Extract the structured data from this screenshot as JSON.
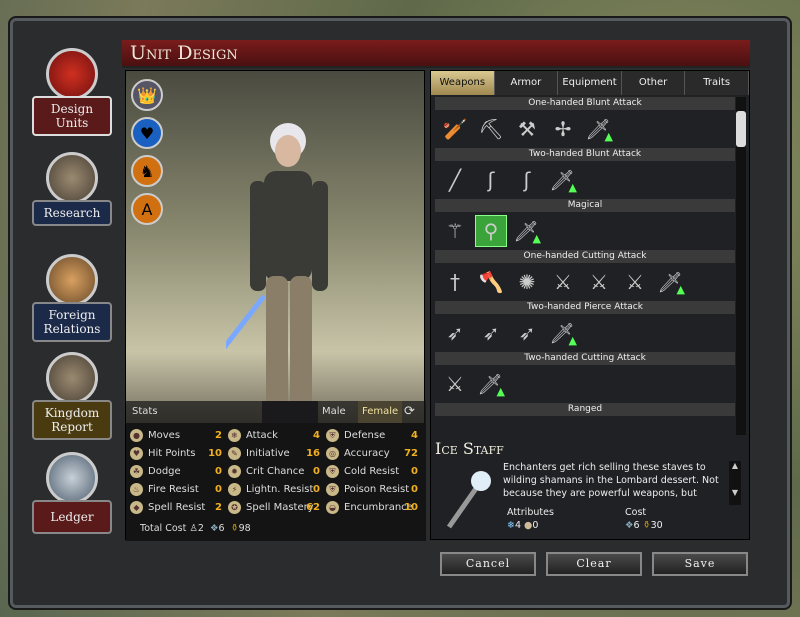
{
  "title": "Unit Design",
  "nav": [
    {
      "label": "Design Units",
      "icon": "fist-icon"
    },
    {
      "label": "Research",
      "icon": "compass-icon"
    },
    {
      "label": "Foreign Relations",
      "icon": "handshake-icon"
    },
    {
      "label": "Kingdom Report",
      "icon": "castle-icon"
    },
    {
      "label": "Ledger",
      "icon": "scroll-icon"
    }
  ],
  "traits": [
    "crown-icon",
    "heart-icon",
    "horse-icon",
    "letter-a-icon"
  ],
  "stats_label": "Stats",
  "gender": {
    "male": "Male",
    "female": "Female",
    "selected": "Female"
  },
  "stats": [
    [
      {
        "label": "Moves",
        "value": "2"
      },
      {
        "label": "Hit Points",
        "value": "10"
      },
      {
        "label": "Dodge",
        "value": "0"
      },
      {
        "label": "Fire Resist",
        "value": "0"
      },
      {
        "label": "Spell Resist",
        "value": "2"
      }
    ],
    [
      {
        "label": "Attack",
        "value": "4"
      },
      {
        "label": "Initiative",
        "value": "16"
      },
      {
        "label": "Crit Chance",
        "value": "0"
      },
      {
        "label": "Lightn. Resist",
        "value": "0"
      },
      {
        "label": "Spell Mastery",
        "value": "62"
      }
    ],
    [
      {
        "label": "Defense",
        "value": "4"
      },
      {
        "label": "Accuracy",
        "value": "72"
      },
      {
        "label": "Cold Resist",
        "value": "0"
      },
      {
        "label": "Poison Resist",
        "value": "0"
      },
      {
        "label": "Encumbrance",
        "value": "10"
      }
    ]
  ],
  "total_cost": {
    "label": "Total Cost",
    "metal": "2",
    "crystal": "6",
    "gold": "98"
  },
  "tabs": [
    "Weapons",
    "Armor",
    "Equipment",
    "Other",
    "Traits"
  ],
  "active_tab": "Weapons",
  "categories": [
    {
      "name": "One-handed Blunt Attack",
      "items": [
        "club",
        "pickaxe",
        "axe-mace",
        "spiked-mace",
        "sword-upgrade"
      ]
    },
    {
      "name": "Two-handed Blunt Attack",
      "items": [
        "staff",
        "crook",
        "crook2",
        "sword-upgrade"
      ]
    },
    {
      "name": "Magical",
      "items": [
        "fire-staff",
        "ice-staff",
        "sword-upgrade"
      ],
      "selected": "ice-staff"
    },
    {
      "name": "One-handed Cutting Attack",
      "items": [
        "dagger",
        "hand-axe",
        "flaming-axe",
        "sword",
        "sword",
        "sword",
        "sword-upgrade"
      ]
    },
    {
      "name": "Two-handed Pierce Attack",
      "items": [
        "spear",
        "spear",
        "spear",
        "sword-upgrade"
      ]
    },
    {
      "name": "Two-handed Cutting Attack",
      "items": [
        "battle-axe",
        "sword-upgrade"
      ]
    },
    {
      "name": "Ranged",
      "items": []
    }
  ],
  "detail": {
    "name": "Ice Staff",
    "description": "Enchanters get rich selling these staves to wilding shamans in the Lombard dessert.  Not because they are powerful weapons, but",
    "attributes_label": "Attributes",
    "attr1": "4",
    "attr2": "0",
    "cost_label": "Cost",
    "cost_crystal": "6",
    "cost_gold": "30"
  },
  "buttons": {
    "cancel": "Cancel",
    "clear": "Clear",
    "save": "Save"
  }
}
